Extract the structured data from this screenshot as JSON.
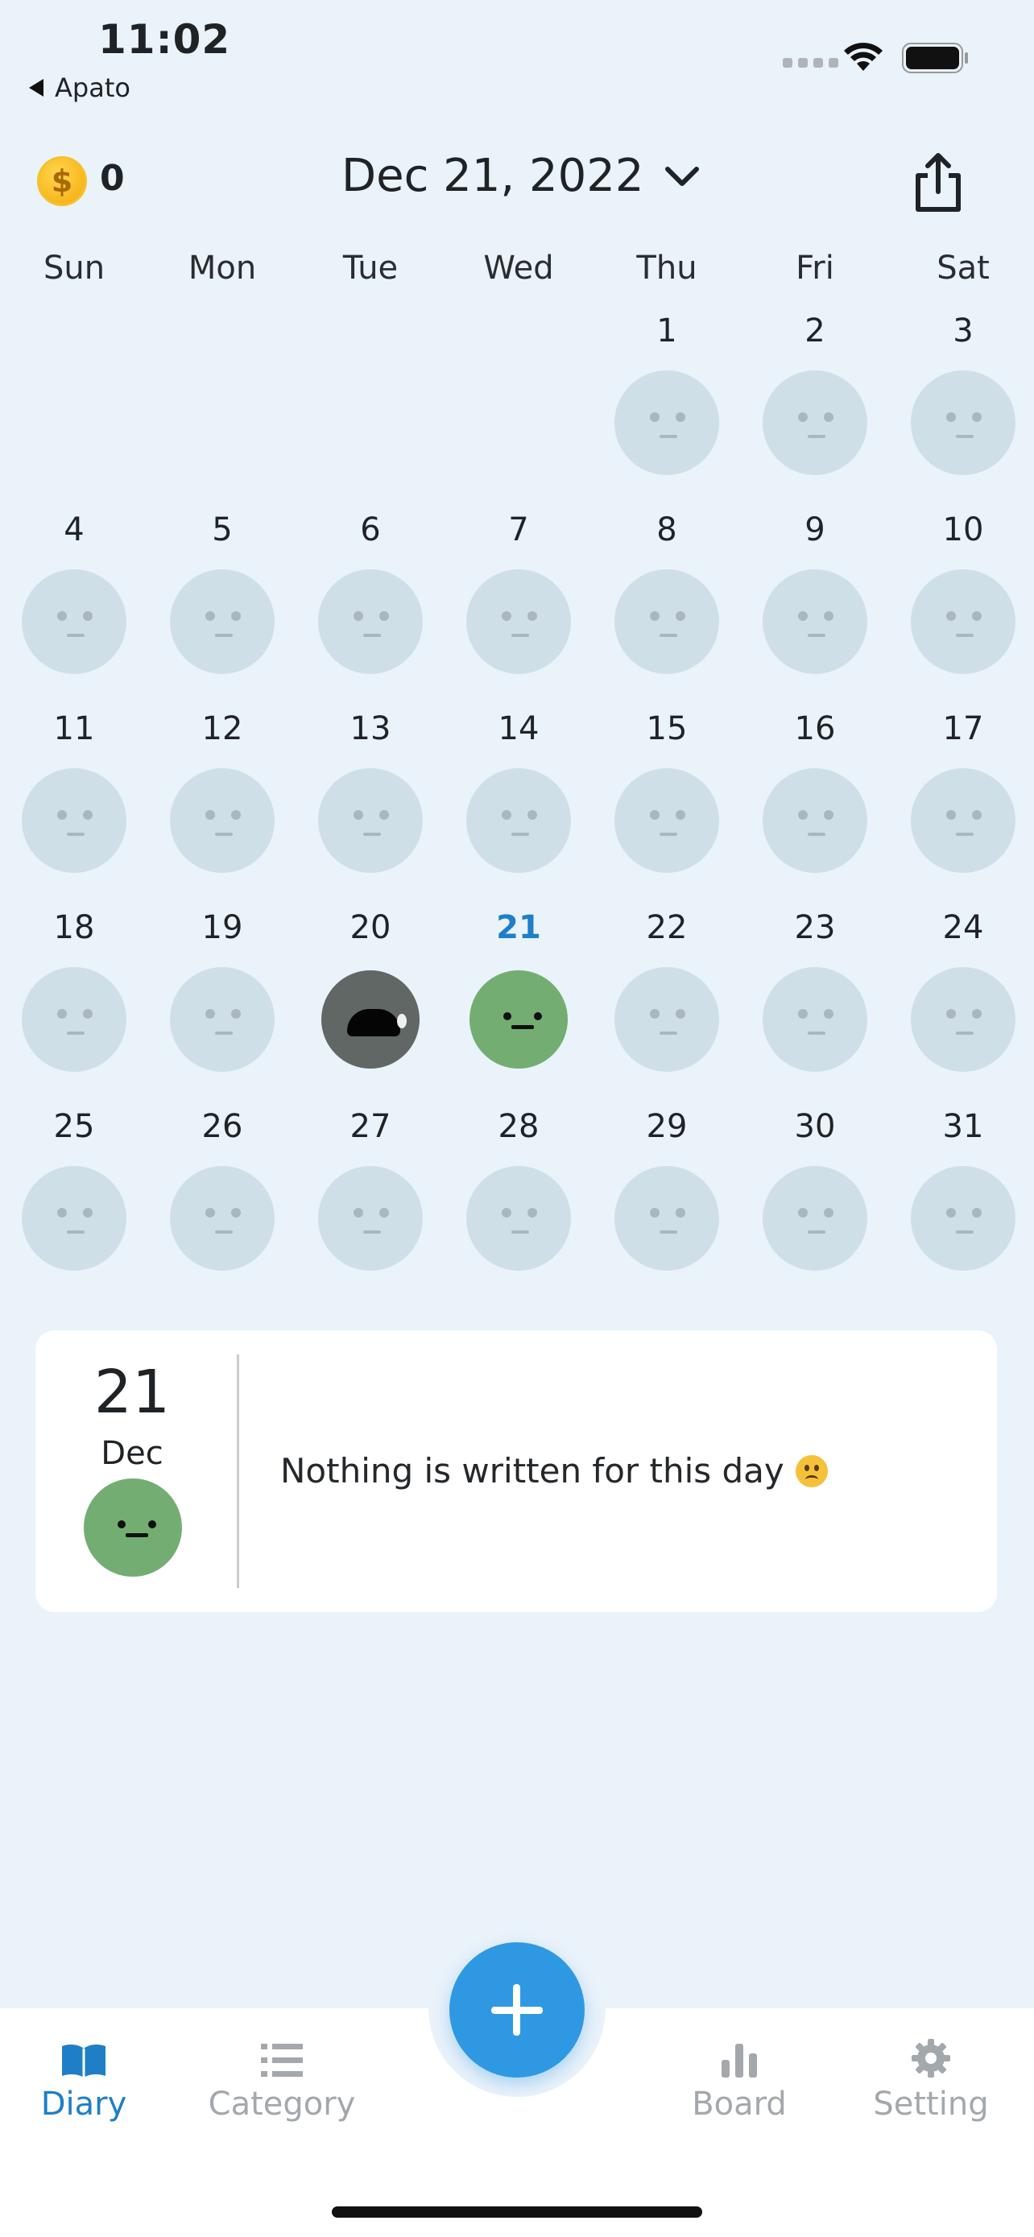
{
  "status_bar": {
    "time": "11:02",
    "back_label": "Apato"
  },
  "header": {
    "coins": "0",
    "date_title": "Dec 21, 2022"
  },
  "calendar": {
    "weekdays": [
      "Sun",
      "Mon",
      "Tue",
      "Wed",
      "Thu",
      "Fri",
      "Sat"
    ],
    "today": 21,
    "days": [
      {
        "day": 1,
        "mood": "empty"
      },
      {
        "day": 2,
        "mood": "empty"
      },
      {
        "day": 3,
        "mood": "empty"
      },
      {
        "day": 4,
        "mood": "empty"
      },
      {
        "day": 5,
        "mood": "empty"
      },
      {
        "day": 6,
        "mood": "empty"
      },
      {
        "day": 7,
        "mood": "empty"
      },
      {
        "day": 8,
        "mood": "empty"
      },
      {
        "day": 9,
        "mood": "empty"
      },
      {
        "day": 10,
        "mood": "empty"
      },
      {
        "day": 11,
        "mood": "empty"
      },
      {
        "day": 12,
        "mood": "empty"
      },
      {
        "day": 13,
        "mood": "empty"
      },
      {
        "day": 14,
        "mood": "empty"
      },
      {
        "day": 15,
        "mood": "empty"
      },
      {
        "day": 16,
        "mood": "empty"
      },
      {
        "day": 17,
        "mood": "empty"
      },
      {
        "day": 18,
        "mood": "empty"
      },
      {
        "day": 19,
        "mood": "empty"
      },
      {
        "day": 20,
        "mood": "crying"
      },
      {
        "day": 21,
        "mood": "neutral-green"
      },
      {
        "day": 22,
        "mood": "empty"
      },
      {
        "day": 23,
        "mood": "empty"
      },
      {
        "day": 24,
        "mood": "empty"
      },
      {
        "day": 25,
        "mood": "empty"
      },
      {
        "day": 26,
        "mood": "empty"
      },
      {
        "day": 27,
        "mood": "empty"
      },
      {
        "day": 28,
        "mood": "empty"
      },
      {
        "day": 29,
        "mood": "empty"
      },
      {
        "day": 30,
        "mood": "empty"
      },
      {
        "day": 31,
        "mood": "empty"
      }
    ]
  },
  "entry_card": {
    "day": "21",
    "month": "Dec",
    "mood": "neutral-green",
    "message": "Nothing is written for this day"
  },
  "tab_bar": {
    "items": [
      {
        "label": "Diary",
        "icon": "book-icon",
        "active": true
      },
      {
        "label": "Category",
        "icon": "list-icon",
        "active": false
      },
      {
        "label": "Board",
        "icon": "bar-chart-icon",
        "active": false
      },
      {
        "label": "Setting",
        "icon": "gear-icon",
        "active": false
      }
    ],
    "add_button_icon": "plus-icon"
  },
  "colors": {
    "accent": "#1e7fc7",
    "fab": "#2e99e2",
    "background": "#eaf2fa",
    "mood_green": "#73ad72",
    "mood_dark": "#606764"
  }
}
